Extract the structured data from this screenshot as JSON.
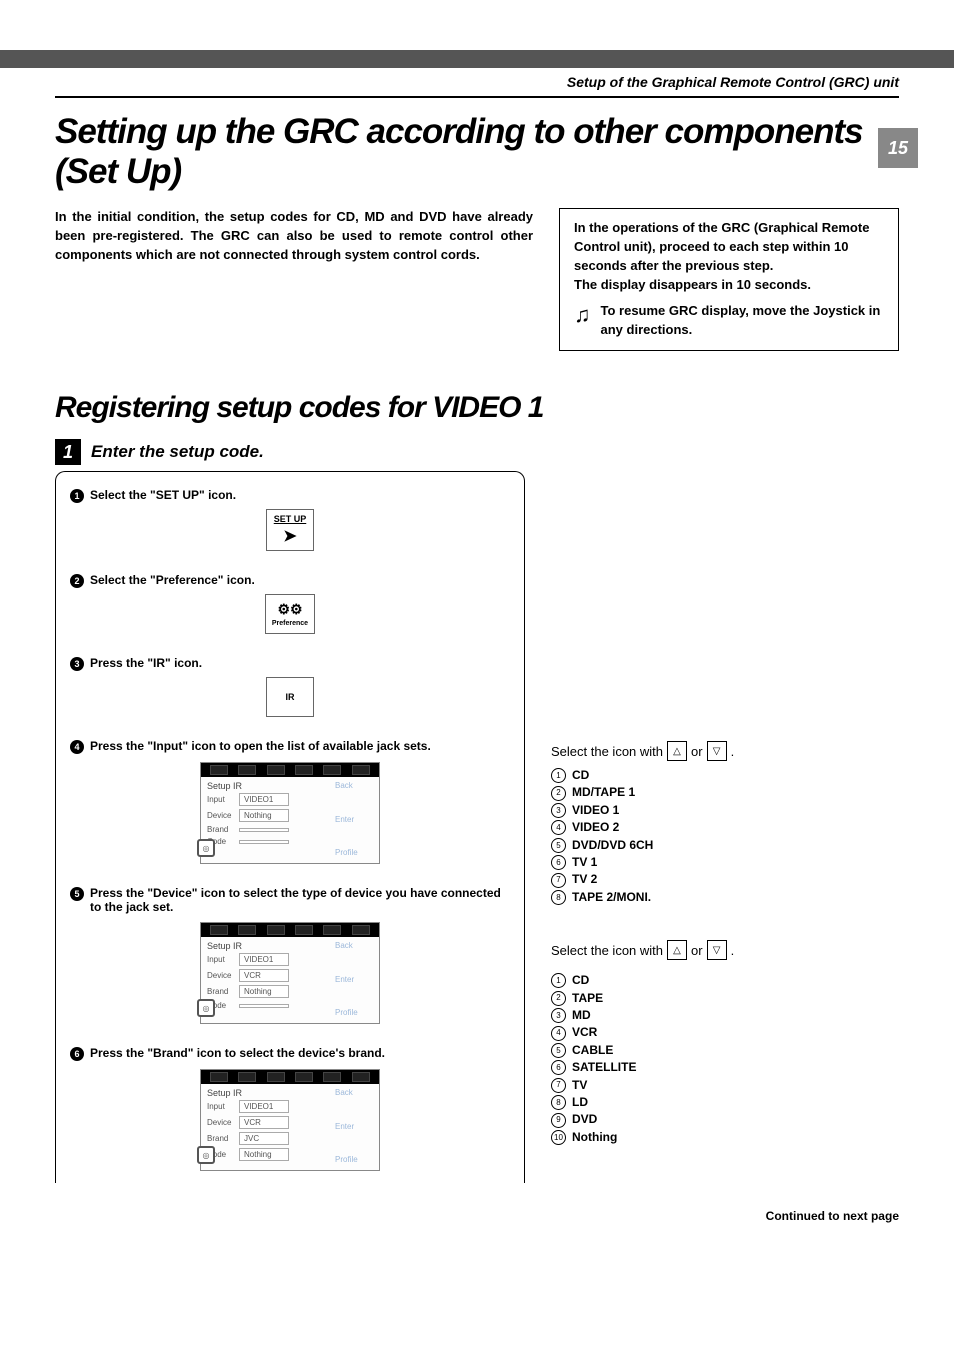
{
  "header": "Setup of the Graphical Remote Control (GRC) unit",
  "page_number": "15",
  "main_title": "Setting up the GRC according to other components (Set Up)",
  "intro": "In the initial condition, the setup codes for CD, MD and DVD have already been pre-registered.  The GRC can also be used to remote control other components which are not connected through system control cords.",
  "note_box": {
    "line1": "In the operations of the GRC (Graphical Remote Control unit), proceed to each step within 10 seconds after the previous step.",
    "line2": "The display disappears in 10 seconds.",
    "tip": "To resume GRC display, move the Joystick in any directions."
  },
  "section_title": "Registering setup codes for VIDEO 1",
  "step": {
    "number": "1",
    "label": "Enter the setup code."
  },
  "substeps": {
    "s1": {
      "num": "1",
      "text": "Select the \"SET UP\" icon.",
      "icon_label": "SET UP"
    },
    "s2": {
      "num": "2",
      "text": "Select the \"Preference\" icon.",
      "icon_label": "Preference"
    },
    "s3": {
      "num": "3",
      "text": "Press the \"IR\" icon.",
      "icon_label": "IR"
    },
    "s4": {
      "num": "4",
      "text": "Press the \"Input\" icon to open the list of available jack sets."
    },
    "s5": {
      "num": "5",
      "text": "Press the \"Device\" icon to select the type of device you have connected to the jack set."
    },
    "s6": {
      "num": "6",
      "text": "Press the \"Brand\" icon to select the device's brand."
    }
  },
  "screenshot_common": {
    "title": "Setup IR",
    "row_input": "Input",
    "row_device": "Device",
    "row_brand": "Brand",
    "row_code": "Code",
    "btn_back": "Back",
    "btn_enter": "Enter",
    "btn_profile": "Profile"
  },
  "ss4": {
    "input": "VIDEO1",
    "device": "Nothing",
    "brand": "",
    "code": ""
  },
  "ss5": {
    "input": "VIDEO1",
    "device": "VCR",
    "brand": "Nothing",
    "code": ""
  },
  "ss6": {
    "input": "VIDEO1",
    "device": "VCR",
    "brand": "JVC",
    "code": "Nothing"
  },
  "select_line": {
    "pre": "Select the icon with",
    "or": "or",
    "post": "."
  },
  "list1": [
    {
      "n": "1",
      "t": "CD"
    },
    {
      "n": "2",
      "t": "MD/TAPE 1"
    },
    {
      "n": "3",
      "t": "VIDEO 1"
    },
    {
      "n": "4",
      "t": "VIDEO 2"
    },
    {
      "n": "5",
      "t": "DVD/DVD 6CH"
    },
    {
      "n": "6",
      "t": "TV 1"
    },
    {
      "n": "7",
      "t": "TV 2"
    },
    {
      "n": "8",
      "t": "TAPE 2/MONI."
    }
  ],
  "list2": [
    {
      "n": "1",
      "t": "CD"
    },
    {
      "n": "2",
      "t": "TAPE"
    },
    {
      "n": "3",
      "t": "MD"
    },
    {
      "n": "4",
      "t": "VCR"
    },
    {
      "n": "5",
      "t": "CABLE"
    },
    {
      "n": "6",
      "t": "SATELLITE"
    },
    {
      "n": "7",
      "t": "TV"
    },
    {
      "n": "8",
      "t": "LD"
    },
    {
      "n": "9",
      "t": "DVD"
    },
    {
      "n": "10",
      "t": "Nothing"
    }
  ],
  "continued": "Continued to next page"
}
